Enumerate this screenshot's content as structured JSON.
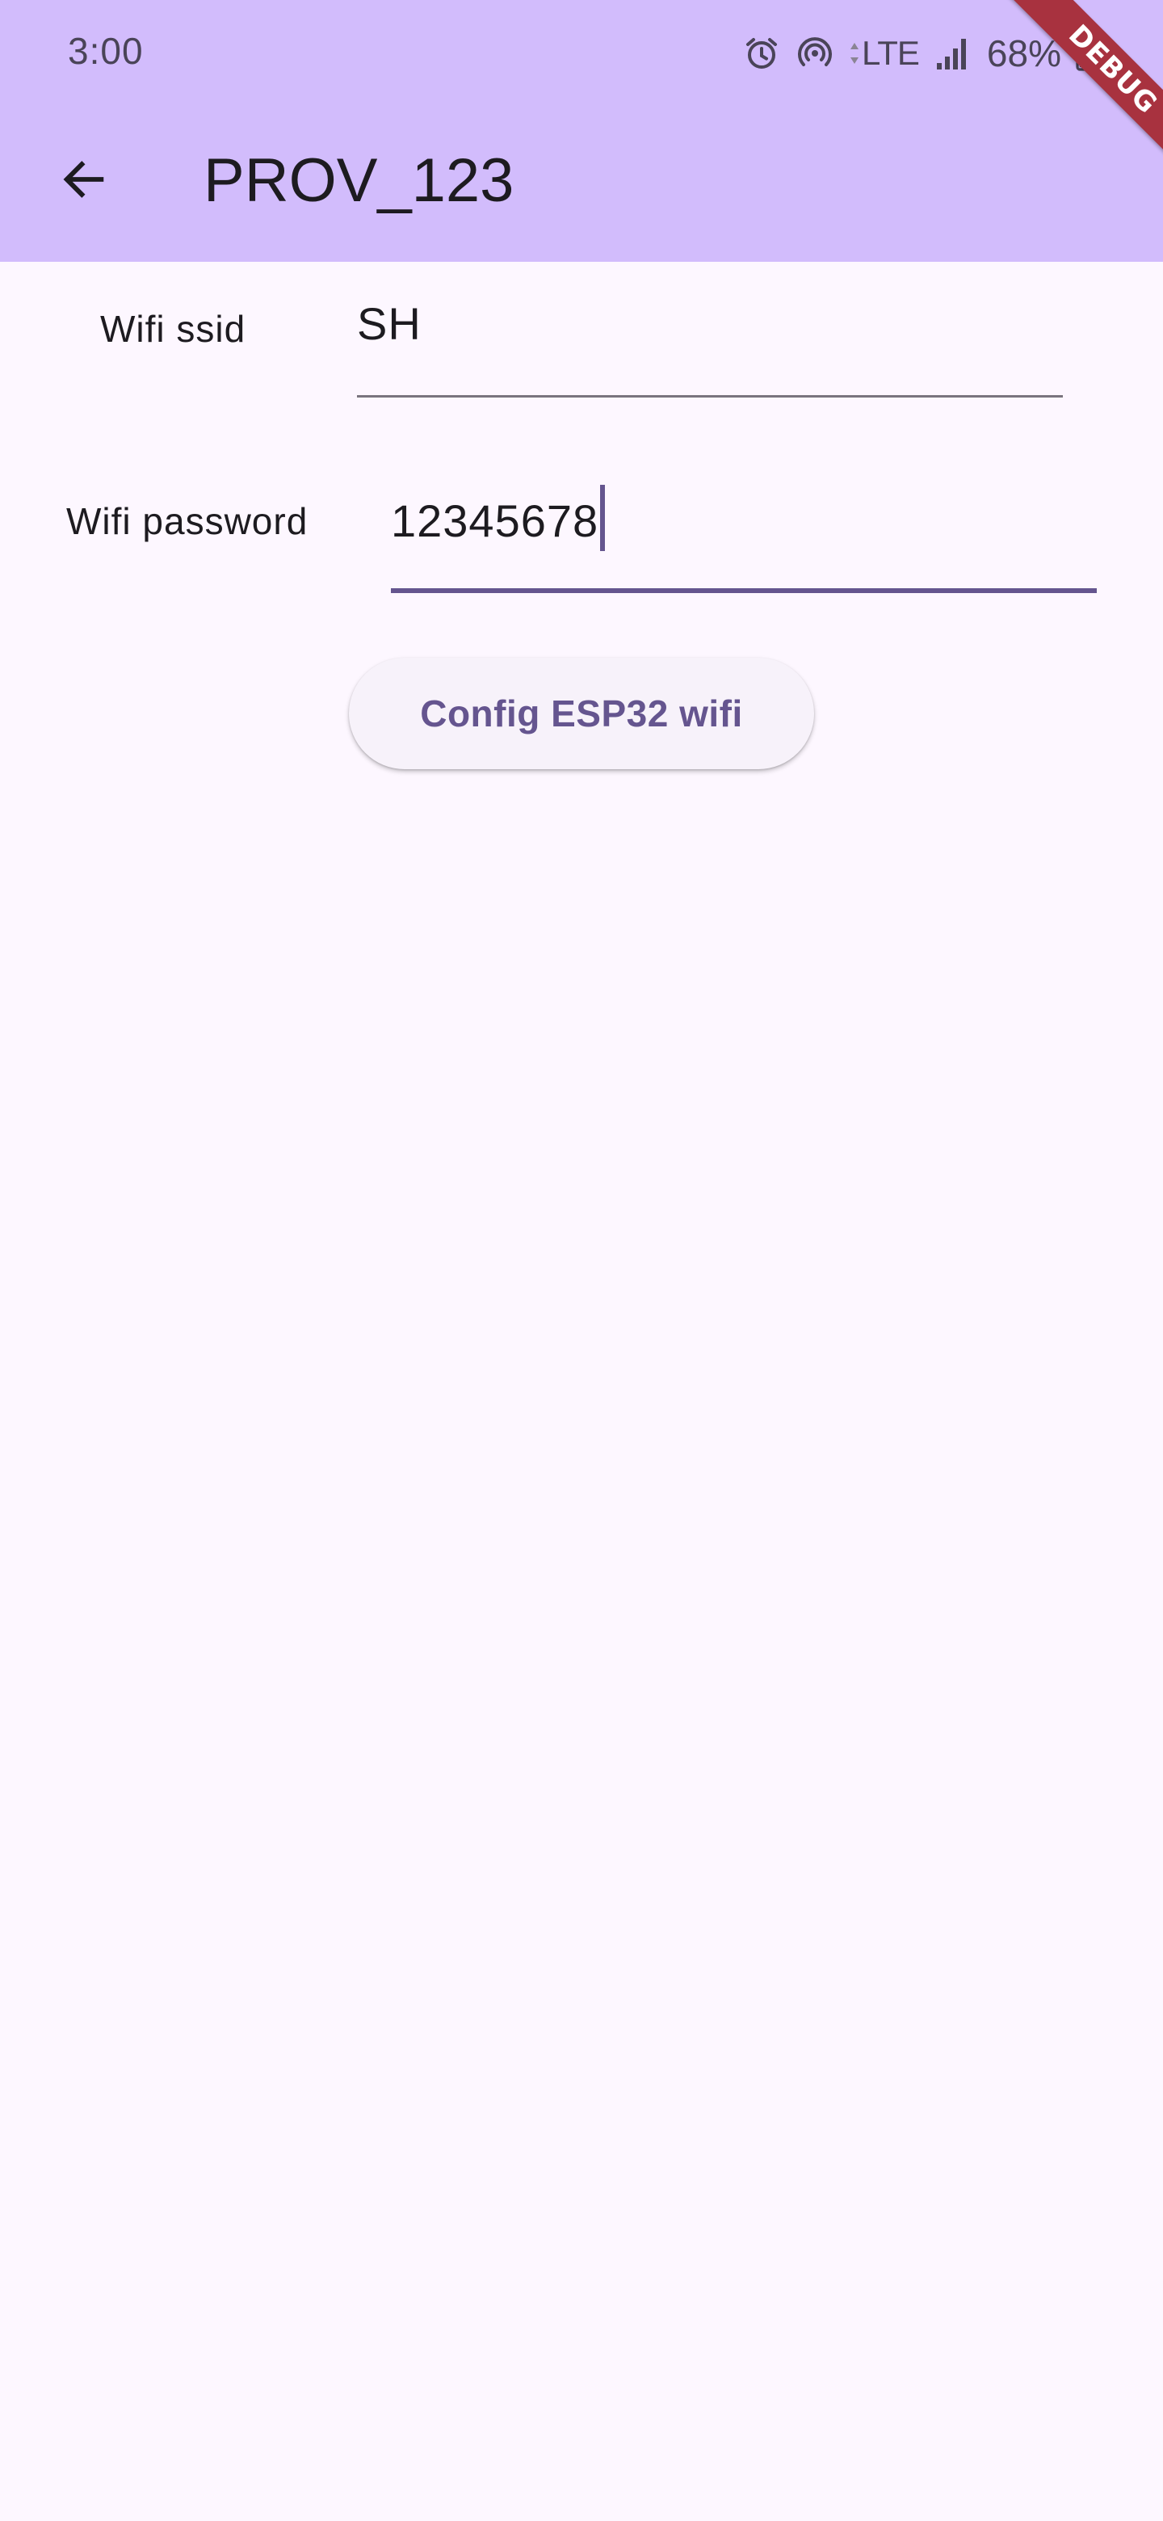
{
  "status_bar": {
    "time": "3:00",
    "network": "LTE",
    "battery": "68%",
    "icons": [
      "alarm-icon",
      "hotspot-icon",
      "lte-icon",
      "signal-icon",
      "battery-icon"
    ]
  },
  "app_bar": {
    "title": "PROV_123",
    "back_icon": "arrow-back-icon"
  },
  "debug_banner": "DEBUG",
  "form": {
    "ssid": {
      "label": "Wifi ssid",
      "value": "SH"
    },
    "password": {
      "label": "Wifi password",
      "value": "12345678"
    },
    "submit_label": "Config ESP32 wifi"
  },
  "colors": {
    "app_bar": "#d2bcfc",
    "background": "#fdf7ff",
    "accent": "#65558f",
    "debug_ribbon": "#a8323f"
  }
}
